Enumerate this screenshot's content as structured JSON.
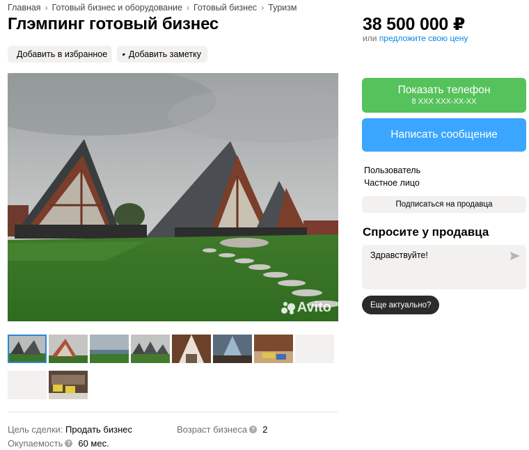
{
  "breadcrumbs": [
    "Главная",
    "Готовый бизнес и оборудование",
    "Готовый бизнес",
    "Туризм"
  ],
  "title": "Глэмпинг готовый бизнес",
  "actions": {
    "favorite": "Добавить в избранное",
    "note": "Добавить заметку"
  },
  "price": "38 500 000 ₽",
  "offer": {
    "prefix": "или",
    "link": "предложите свою цену"
  },
  "contact": {
    "phone_label": "Показать телефон",
    "phone_masked": "8 XXX XXX-XX-XX",
    "message_label": "Написать сообщение"
  },
  "seller": {
    "name": "Пользователь",
    "type": "Частное лицо",
    "subscribe_label": "Подписаться на продавца"
  },
  "ask": {
    "title": "Спросите у продавца",
    "message": "Здравствуйте!",
    "quick_reply": "Еще актуально?"
  },
  "watermark": "Avito",
  "params": {
    "deal_key": "Цель сделки:",
    "deal_value": "Продать бизнес",
    "age_key": "Возраст бизнеса",
    "age_value": "2",
    "payback_key": "Окупаемость",
    "payback_value": "60 мес."
  },
  "colors": {
    "green": "#56c25b",
    "blue": "#3aa6ff",
    "link": "#0a88e8"
  }
}
